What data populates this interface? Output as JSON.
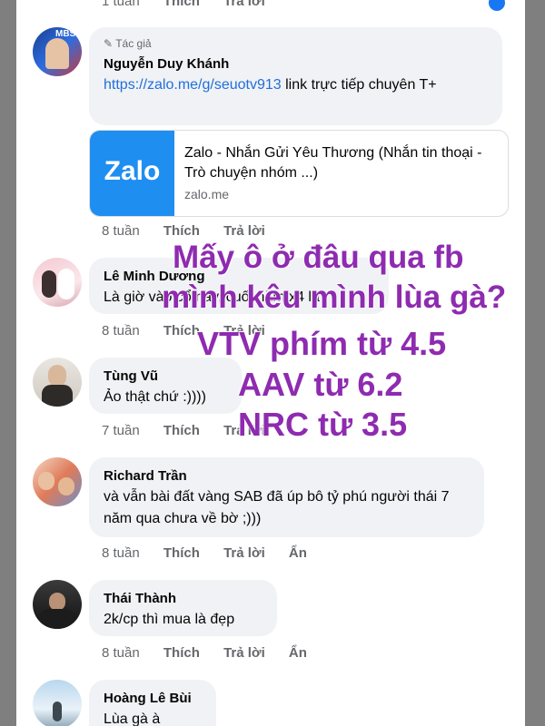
{
  "top_meta": {
    "time": "1 tuần",
    "like": "Thích",
    "reply": "Trả lời"
  },
  "comments": [
    {
      "author_badge": "Tác giả",
      "name": "Nguyễn Duy Khánh",
      "link_text": "https://zalo.me/g/seuotv913",
      "text_after_link": " link trực tiếp chuyên T+",
      "preview": {
        "logo_text": "Zalo",
        "title": "Zalo - Nhắn Gửi Yêu Thương (Nhắn tin thoại - Trò chuyện nhóm ...)",
        "domain": "zalo.me"
      },
      "time": "8 tuần",
      "like": "Thích",
      "reply": "Trả lời"
    },
    {
      "name": "Lê Minh Dương",
      "text": "Là giờ vào cổ này, cuối năm x4 là",
      "time": "8 tuần",
      "like": "Thích",
      "reply": "Trả lời"
    },
    {
      "name": "Tùng Vũ",
      "text": "Ảo thật chứ :))))",
      "time": "7 tuần",
      "like": "Thích",
      "reply": "Trả lời"
    },
    {
      "name": "Richard Trần",
      "text": "và vẫn bài đất vàng SAB đã úp bô tỷ phú người thái 7 năm qua chưa về bờ ;)))",
      "time": "8 tuần",
      "like": "Thích",
      "reply": "Trả lời",
      "hide": "Ẩn"
    },
    {
      "name": "Thái Thành",
      "text": "2k/cp thì mua là đẹp",
      "time": "8 tuần",
      "like": "Thích",
      "reply": "Trả lời",
      "hide": "Ẩn"
    },
    {
      "name": "Hoàng Lê Bùi",
      "text": "Lùa gà à"
    }
  ],
  "overlay_lines": [
    "Mấy ô ở đâu qua fb",
    "mình kêu mình lùa gà?",
    "VTV phím từ 4.5",
    "AAV từ 6.2",
    "NRC từ 3.5"
  ],
  "colors": {
    "overlay": "#8e2bb0",
    "link": "#216fdb",
    "bubble": "#f0f2f5"
  }
}
